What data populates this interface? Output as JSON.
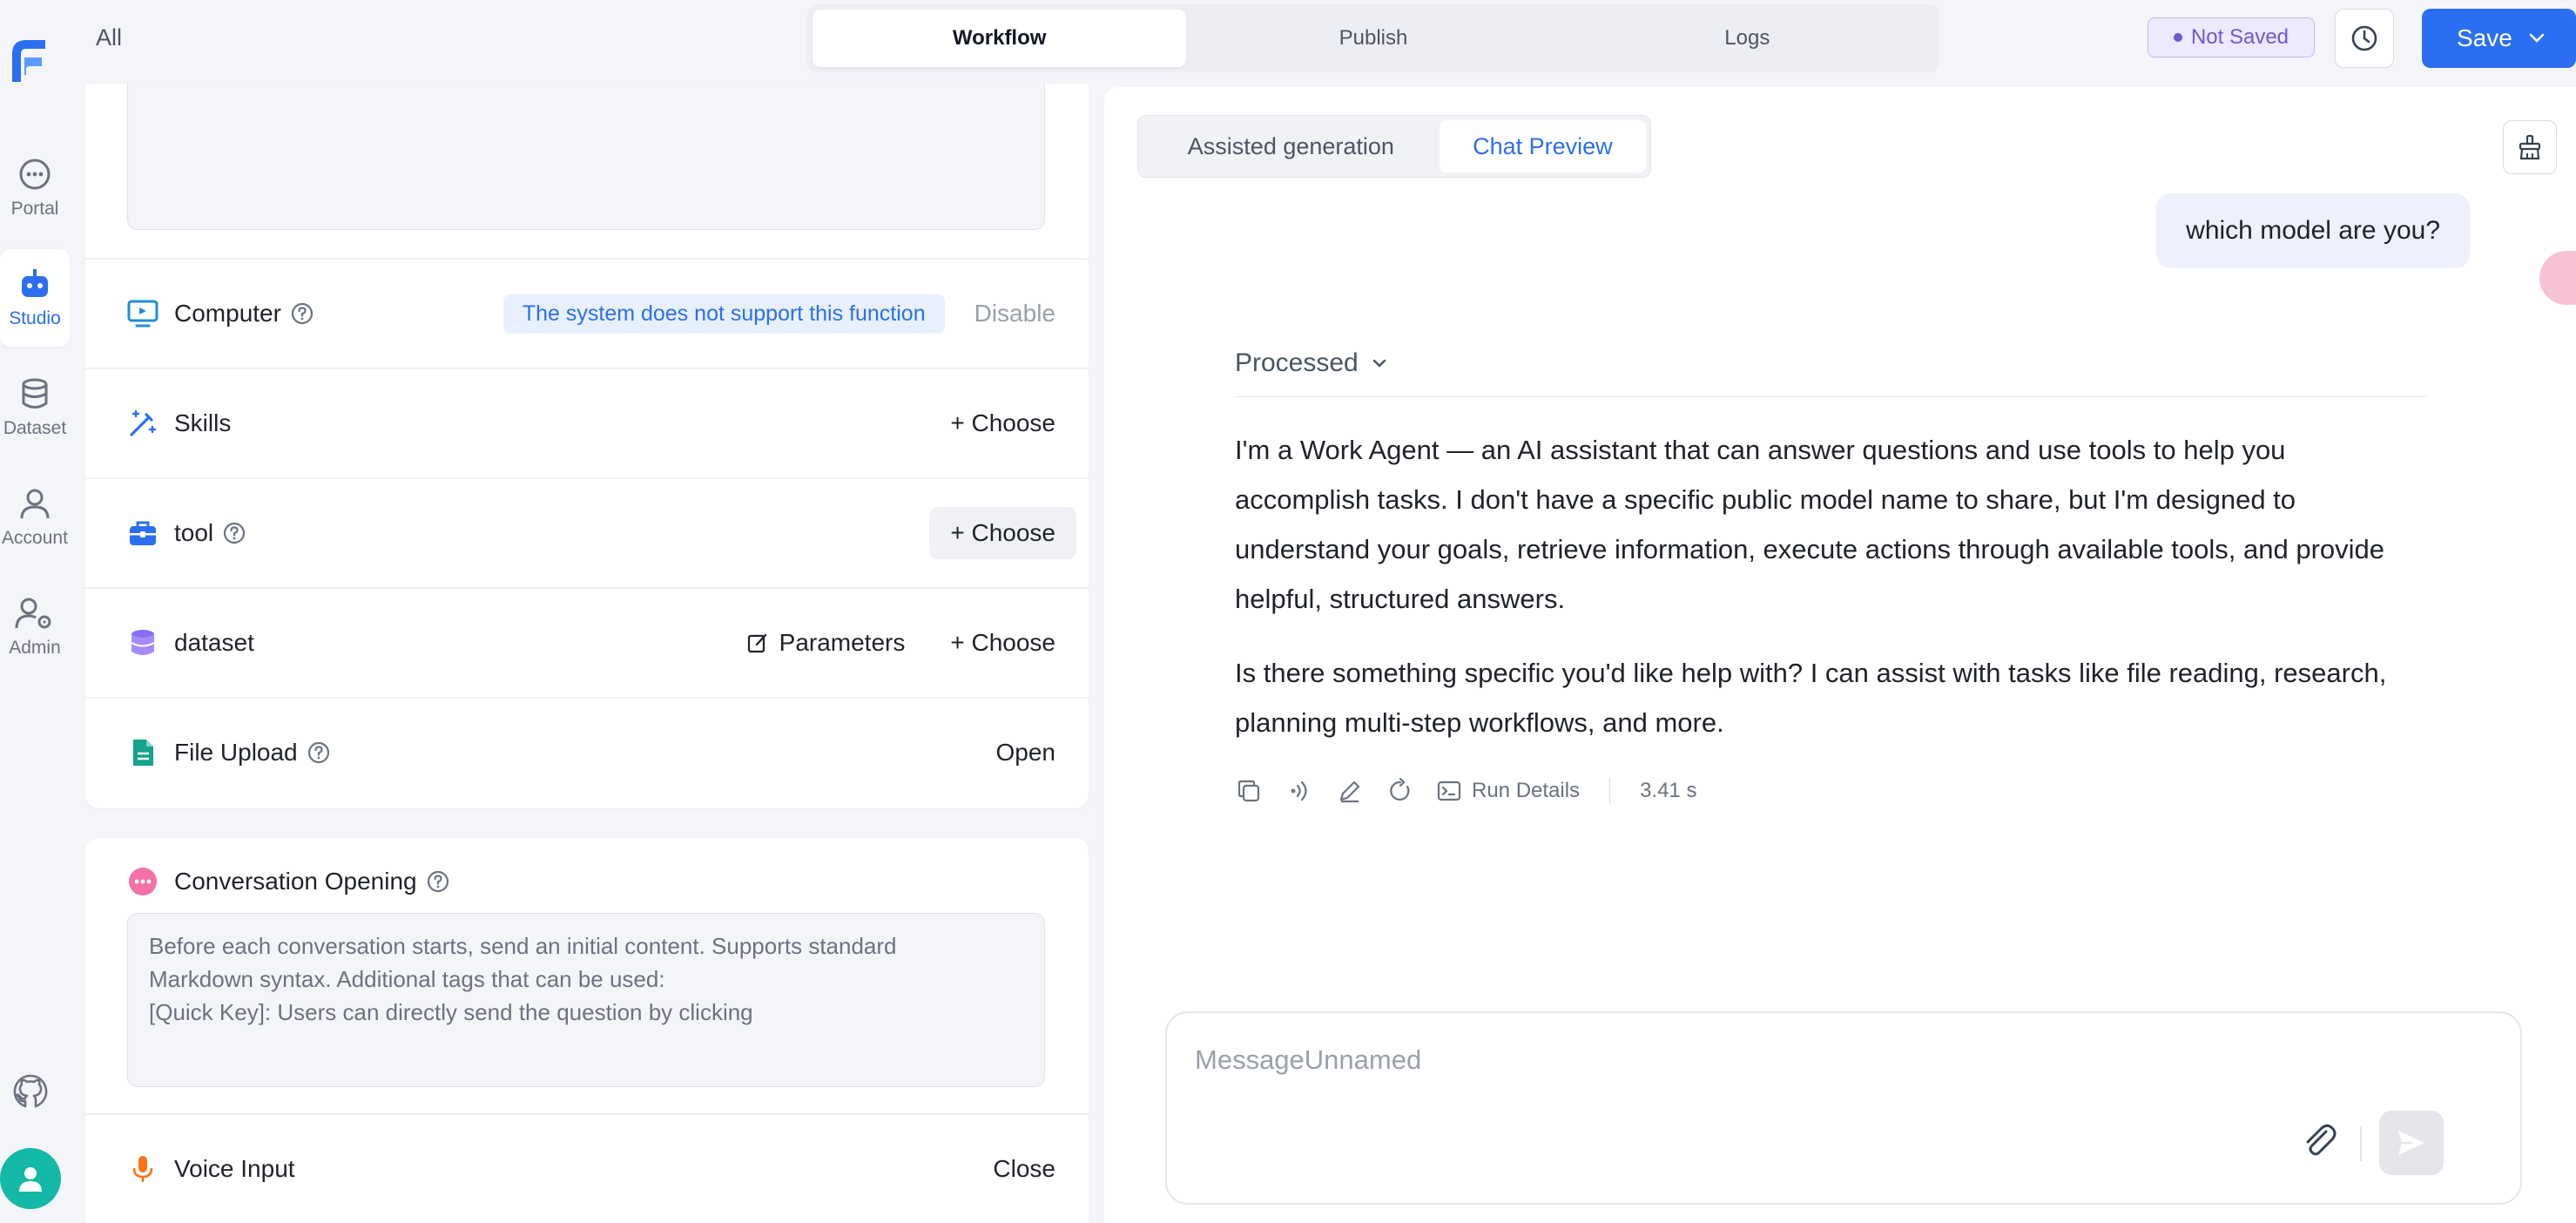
{
  "nav": {
    "items": [
      {
        "label": "Portal",
        "icon": "chat-bubble-icon"
      },
      {
        "label": "Studio",
        "icon": "robot-icon"
      },
      {
        "label": "Dataset",
        "icon": "database-icon"
      },
      {
        "label": "Account",
        "icon": "user-icon"
      },
      {
        "label": "Admin",
        "icon": "user-settings-icon"
      }
    ],
    "active": "Studio"
  },
  "header": {
    "scope": "All",
    "tabs": [
      "Workflow",
      "Publish",
      "Logs"
    ],
    "active_tab": "Workflow",
    "status": "Not Saved",
    "save_label": "Save"
  },
  "config": {
    "computer": {
      "title": "Computer",
      "note": "The system does not support this function",
      "action": "Disable"
    },
    "skills": {
      "title": "Skills",
      "action": "+ Choose"
    },
    "tool": {
      "title": "tool",
      "action": "+ Choose"
    },
    "dataset": {
      "title": "dataset",
      "params": "Parameters",
      "action": "+ Choose"
    },
    "file_upload": {
      "title": "File Upload",
      "action": "Open"
    },
    "opening": {
      "title": "Conversation Opening",
      "placeholder_lines": [
        "Before each conversation starts, send an initial content. Supports standard",
        "Markdown syntax. Additional tags that can be used:",
        "[Quick Key]: Users can directly send the question by clicking"
      ]
    },
    "voice_input": {
      "title": "Voice Input",
      "action": "Close"
    }
  },
  "chat": {
    "tabs": [
      "Assisted generation",
      "Chat Preview"
    ],
    "active_tab": "Chat Preview",
    "user_message": "which model are you?",
    "processed_label": "Processed",
    "answer_lines_1": [
      "I'm a Work Agent — an AI assistant that can answer questions and use tools to help you",
      "accomplish tasks. I don't have a specific public model name to share, but I'm designed to",
      "understand your goals, retrieve information, execute actions through available tools, and provide",
      "helpful, structured answers."
    ],
    "answer_lines_2": [
      "Is there something specific you'd like help with? I can assist with tasks like file reading, research,",
      "planning multi-step workflows, and more."
    ],
    "run_details": "Run Details",
    "duration": "3.41 s",
    "input_placeholder": "MessageUnnamed"
  },
  "colors": {
    "accent": "#2b6ff0",
    "status": "#6d5ad6"
  }
}
